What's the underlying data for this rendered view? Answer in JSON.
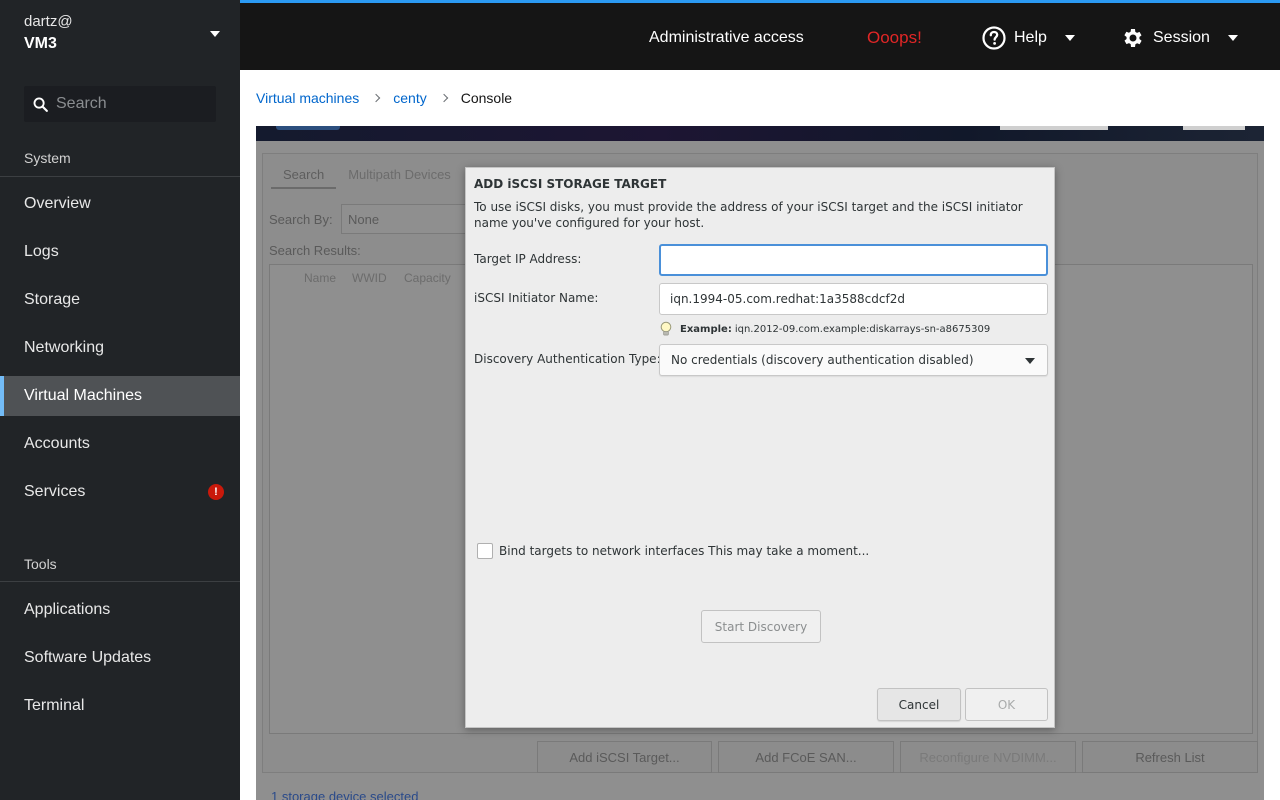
{
  "sidebar": {
    "user": "dartz@",
    "host": "VM3",
    "search_placeholder": "Search",
    "system_title": "System",
    "system_items": [
      {
        "label": "Overview"
      },
      {
        "label": "Logs"
      },
      {
        "label": "Storage"
      },
      {
        "label": "Networking"
      },
      {
        "label": "Virtual Machines",
        "active": true
      },
      {
        "label": "Accounts"
      },
      {
        "label": "Services",
        "badge": "!"
      }
    ],
    "tools_title": "Tools",
    "tools_items": [
      {
        "label": "Applications"
      },
      {
        "label": "Software Updates"
      },
      {
        "label": "Terminal"
      }
    ]
  },
  "topbar": {
    "admin_access": "Administrative access",
    "ooops": "Ooops!",
    "help": "Help",
    "session": "Session"
  },
  "breadcrumb": {
    "items": [
      "Virtual machines",
      "centy"
    ],
    "current": "Console"
  },
  "background": {
    "tab_search": "Search",
    "tab_multipath": "Multipath Devices",
    "search_by_label": "Search By:",
    "search_by_value": "None",
    "search_results_label": "Search Results:",
    "columns": [
      "Name",
      "WWID",
      "Capacity"
    ],
    "buttons": [
      "Add iSCSI Target...",
      "Add FCoE SAN...",
      "Reconfigure NVDIMM...",
      "Refresh List"
    ],
    "status": "1 storage device selected"
  },
  "dialog": {
    "title": "ADD iSCSI STORAGE TARGET",
    "description": "To use iSCSI disks, you must provide the address of your iSCSI target and the iSCSI initiator name you've configured for your host.",
    "target_ip_label": "Target IP Address:",
    "target_ip_value": "",
    "initiator_label": "iSCSI Initiator Name:",
    "initiator_value": "iqn.1994-05.com.redhat:1a3588cdcf2d",
    "example_label": "Example:",
    "example_value": "iqn.2012-09.com.example:diskarrays-sn-a8675309",
    "discovery_auth_label": "Discovery Authentication Type:",
    "discovery_auth_value": "No credentials (discovery authentication disabled)",
    "bind_targets_label": "Bind targets to network interfaces This may take a moment...",
    "start_discovery": "Start Discovery",
    "cancel": "Cancel",
    "ok": "OK"
  },
  "colors": {
    "sidebar_bg": "#212427",
    "topbar_bg": "#151515",
    "accent_blue": "#2b9af3",
    "link_blue": "#0066cc",
    "error_red": "#e02626",
    "active_nav": "#4f5255"
  },
  "icons": {
    "search": "search-icon",
    "help": "question-circle-icon",
    "session": "gear-icon",
    "services_badge": "exclamation-circle-icon",
    "example": "lightbulb-icon"
  }
}
